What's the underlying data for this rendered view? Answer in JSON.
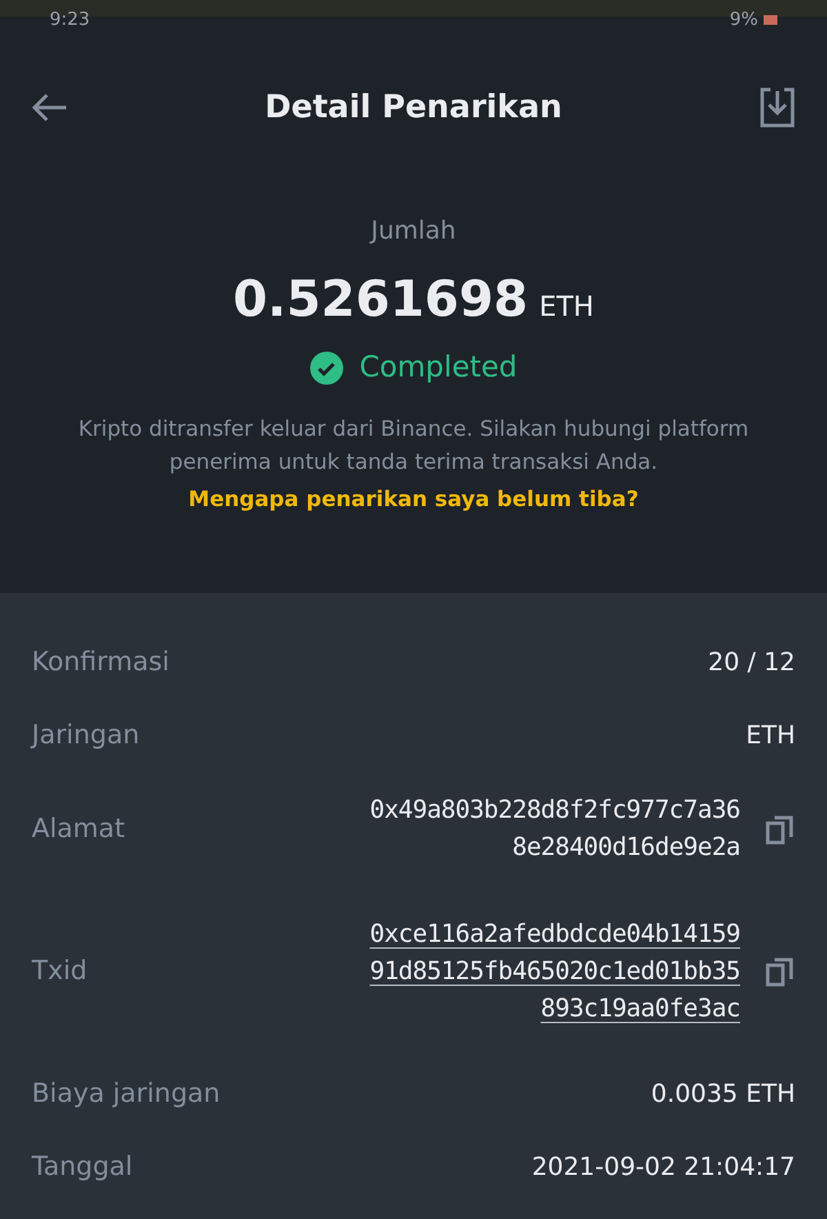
{
  "status_bar": {
    "time": "9:23",
    "battery": "9%"
  },
  "header": {
    "title": "Detail Penarikan"
  },
  "summary": {
    "label": "Jumlah",
    "amount": "0.5261698",
    "unit": "ETH",
    "status": "Completed",
    "note": "Kripto ditransfer keluar dari Binance. Silakan hubungi platform penerima untuk tanda terima transaksi Anda.",
    "link": "Mengapa penarikan saya belum tiba?"
  },
  "details": [
    {
      "label": "Konfirmasi",
      "kind": "text",
      "lines": [
        "20 / 12"
      ]
    },
    {
      "label": "Jaringan",
      "kind": "text",
      "lines": [
        "ETH"
      ]
    },
    {
      "label": "Alamat",
      "kind": "copy",
      "lines": [
        "0x49a803b228d8f2fc977c7a36",
        "8e28400d16de9e2a"
      ]
    },
    {
      "label": "Txid",
      "kind": "link",
      "lines": [
        "0xce116a2afedbdcde04b14159",
        "91d85125fb465020c1ed01bb35",
        "893c19aa0fe3ac"
      ]
    },
    {
      "label": "Biaya jaringan",
      "kind": "text",
      "lines": [
        "0.0035 ETH"
      ]
    },
    {
      "label": "Tanggal",
      "kind": "text",
      "lines": [
        "2021-09-02 21:04:17"
      ]
    }
  ]
}
